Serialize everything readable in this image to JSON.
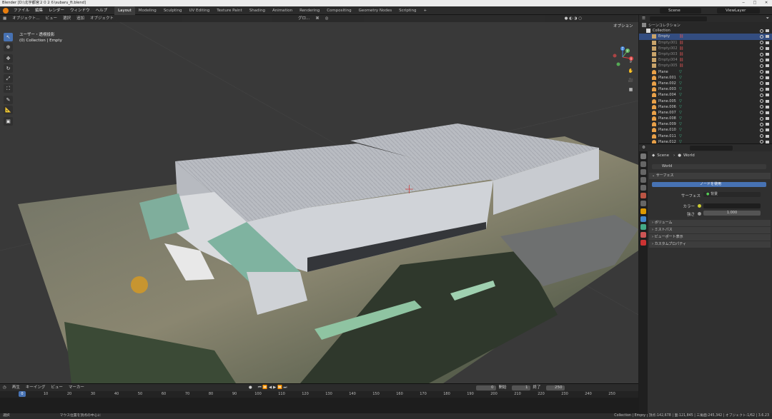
{
  "window": {
    "title": "Blender [D:\\北宇都宮２０２６\\subaru_ft.blend]",
    "min": "─",
    "max": "□",
    "close": "✕"
  },
  "menu": {
    "items": [
      "ファイル",
      "編集",
      "レンダー",
      "ウィンドウ",
      "ヘルプ"
    ],
    "workspaces": [
      "Layout",
      "Modeling",
      "Sculpting",
      "UV Editing",
      "Texture Paint",
      "Shading",
      "Animation",
      "Rendering",
      "Compositing",
      "Geometry Nodes",
      "Scripting"
    ],
    "active_workspace": "Layout",
    "add": "+",
    "scene": "Scene",
    "view_layer": "ViewLayer"
  },
  "viewport": {
    "mode": "オブジェクト...",
    "menus": [
      "ビュー",
      "選択",
      "追加",
      "オブジェクト"
    ],
    "transform": "グロ...",
    "options": "オプション",
    "view_name": "ユーザー・透視投影",
    "context": "(0) Collection | Empty",
    "gizmo": {
      "x": "X",
      "y": "Y",
      "z": "Z"
    }
  },
  "timeline": {
    "menus": [
      "再生",
      "キーイング",
      "ビュー",
      "マーカー"
    ],
    "current": "0",
    "start_label": "開始",
    "start": "1",
    "end_label": "終了",
    "end": "250",
    "ticks": [
      "0",
      "10",
      "20",
      "30",
      "40",
      "50",
      "60",
      "70",
      "80",
      "90",
      "100",
      "110",
      "120",
      "130",
      "140",
      "150",
      "160",
      "170",
      "180",
      "190",
      "200",
      "210",
      "220",
      "230",
      "240",
      "250"
    ]
  },
  "status": {
    "left": "選択",
    "middle": "マウス位置を頂点の中心に",
    "right": "Collection | Empty | 頂点:142,678 | 面:121,845 | 三角面:245,342 | オブジェクト:1/62 | 3.6.23"
  },
  "outliner": {
    "root": "シーンコレクション",
    "collection": "Collection",
    "items": [
      {
        "name": "Empty",
        "type": "empty",
        "selected": true
      },
      {
        "name": "Empty.001",
        "type": "empty",
        "dim": true
      },
      {
        "name": "Empty.002",
        "type": "empty",
        "dim": true
      },
      {
        "name": "Empty.003",
        "type": "empty",
        "dim": true
      },
      {
        "name": "Empty.004",
        "type": "empty",
        "dim": true
      },
      {
        "name": "Empty.005",
        "type": "empty",
        "dim": true
      },
      {
        "name": "Plane",
        "type": "mesh"
      },
      {
        "name": "Plane.001",
        "type": "mesh"
      },
      {
        "name": "Plane.002",
        "type": "mesh"
      },
      {
        "name": "Plane.003",
        "type": "mesh"
      },
      {
        "name": "Plane.004",
        "type": "mesh"
      },
      {
        "name": "Plane.005",
        "type": "mesh"
      },
      {
        "name": "Plane.006",
        "type": "mesh"
      },
      {
        "name": "Plane.007",
        "type": "mesh"
      },
      {
        "name": "Plane.008",
        "type": "mesh"
      },
      {
        "name": "Plane.009",
        "type": "mesh"
      },
      {
        "name": "Plane.010",
        "type": "mesh"
      },
      {
        "name": "Plane.011",
        "type": "mesh"
      },
      {
        "name": "Plane.012",
        "type": "mesh"
      }
    ]
  },
  "properties": {
    "breadcrumb_scene": "Scene",
    "breadcrumb_world": "World",
    "world_name": "World",
    "surface_panel": "サーフェス",
    "use_nodes": "ノードを使用",
    "surface_label": "サーフェス",
    "surface_value": "背景",
    "color_label": "カラー",
    "strength_label": "強さ",
    "strength_value": "1.000",
    "panels": [
      "ボリューム",
      "ミストパス",
      "ビューポート表示",
      "カスタムプロパティ"
    ]
  },
  "colors": {
    "accent": "#4772b3",
    "orange": "#e87d0d"
  }
}
